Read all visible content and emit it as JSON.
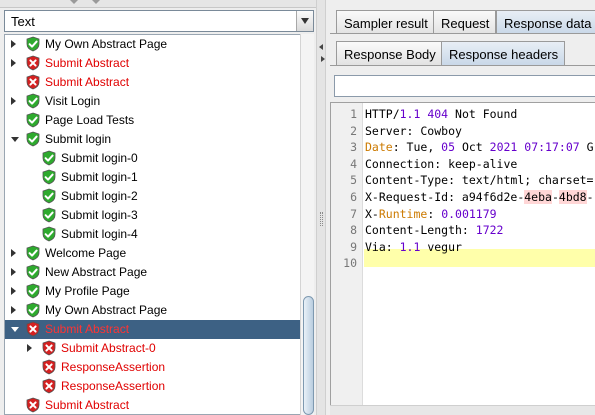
{
  "view_selector": {
    "value": "Text"
  },
  "tree": {
    "items": [
      {
        "label": "My Own Abstract Page",
        "status": "ok",
        "depth": 0,
        "expander": "collapsed",
        "selected": false,
        "icon": "shield-check-icon"
      },
      {
        "label": "Submit Abstract",
        "status": "bad",
        "depth": 0,
        "expander": "collapsed",
        "selected": false,
        "icon": "shield-x-icon"
      },
      {
        "label": "Submit Abstract",
        "status": "bad",
        "depth": 0,
        "expander": "none",
        "selected": false,
        "icon": "shield-x-icon"
      },
      {
        "label": "Visit Login",
        "status": "ok",
        "depth": 0,
        "expander": "collapsed",
        "selected": false,
        "icon": "shield-check-icon"
      },
      {
        "label": "Page Load Tests",
        "status": "ok",
        "depth": 0,
        "expander": "none",
        "selected": false,
        "icon": "shield-check-icon"
      },
      {
        "label": "Submit login",
        "status": "ok",
        "depth": 0,
        "expander": "expanded",
        "selected": false,
        "icon": "shield-check-icon"
      },
      {
        "label": "Submit login-0",
        "status": "ok",
        "depth": 1,
        "expander": "none",
        "selected": false,
        "icon": "shield-check-icon"
      },
      {
        "label": "Submit login-1",
        "status": "ok",
        "depth": 1,
        "expander": "none",
        "selected": false,
        "icon": "shield-check-icon"
      },
      {
        "label": "Submit login-2",
        "status": "ok",
        "depth": 1,
        "expander": "none",
        "selected": false,
        "icon": "shield-check-icon"
      },
      {
        "label": "Submit login-3",
        "status": "ok",
        "depth": 1,
        "expander": "none",
        "selected": false,
        "icon": "shield-check-icon"
      },
      {
        "label": "Submit login-4",
        "status": "ok",
        "depth": 1,
        "expander": "none",
        "selected": false,
        "icon": "shield-check-icon"
      },
      {
        "label": "Welcome Page",
        "status": "ok",
        "depth": 0,
        "expander": "collapsed",
        "selected": false,
        "icon": "shield-check-icon"
      },
      {
        "label": "New Abstract Page",
        "status": "ok",
        "depth": 0,
        "expander": "collapsed",
        "selected": false,
        "icon": "shield-check-icon"
      },
      {
        "label": "My Profile Page",
        "status": "ok",
        "depth": 0,
        "expander": "collapsed",
        "selected": false,
        "icon": "shield-check-icon"
      },
      {
        "label": "My Own Abstract Page",
        "status": "ok",
        "depth": 0,
        "expander": "collapsed",
        "selected": false,
        "icon": "shield-check-icon"
      },
      {
        "label": "Submit Abstract",
        "status": "bad",
        "depth": 0,
        "expander": "expanded",
        "selected": true,
        "icon": "shield-x-icon"
      },
      {
        "label": "Submit Abstract-0",
        "status": "bad",
        "depth": 1,
        "expander": "collapsed",
        "selected": false,
        "icon": "shield-x-icon"
      },
      {
        "label": "ResponseAssertion",
        "status": "bad",
        "depth": 1,
        "expander": "none",
        "selected": false,
        "icon": "shield-x-icon"
      },
      {
        "label": "ResponseAssertion",
        "status": "bad",
        "depth": 1,
        "expander": "none",
        "selected": false,
        "icon": "shield-x-icon"
      },
      {
        "label": "Submit Abstract",
        "status": "bad",
        "depth": 0,
        "expander": "none",
        "selected": false,
        "icon": "shield-x-icon"
      }
    ]
  },
  "result_tabs": [
    {
      "label": "Sampler result",
      "active": false
    },
    {
      "label": "Request",
      "active": false
    },
    {
      "label": "Response data",
      "active": true
    }
  ],
  "response_tabs": [
    {
      "label": "Response Body",
      "active": false
    },
    {
      "label": "Response headers",
      "active": true
    }
  ],
  "search": {
    "value": ""
  },
  "response_headers": {
    "lines": [
      [
        {
          "t": "HTTP/"
        },
        {
          "t": "1.1 404",
          "c": "num"
        },
        {
          "t": " Not Found"
        }
      ],
      [
        {
          "t": "Server: Cowboy"
        }
      ],
      [
        {
          "t": "Date",
          "c": "yel"
        },
        {
          "t": ": Tue, "
        },
        {
          "t": "05",
          "c": "num"
        },
        {
          "t": " Oct "
        },
        {
          "t": "2021 07:17:07",
          "c": "num"
        },
        {
          "t": " G"
        }
      ],
      [
        {
          "t": "Connection: keep-alive"
        }
      ],
      [
        {
          "t": "Content-Type: text/html; charset="
        }
      ],
      [
        {
          "t": "X-Request-Id: a94f6d2e-"
        },
        {
          "t": "4eba",
          "c": "hl"
        },
        {
          "t": "-"
        },
        {
          "t": "4bd8",
          "c": "hl"
        },
        {
          "t": "-"
        }
      ],
      [
        {
          "t": "X-"
        },
        {
          "t": "Runtime",
          "c": "yel"
        },
        {
          "t": ": "
        },
        {
          "t": "0.001179",
          "c": "num"
        }
      ],
      [
        {
          "t": "Content-Length: "
        },
        {
          "t": "1722",
          "c": "num"
        }
      ],
      [
        {
          "t": "Via: "
        },
        {
          "t": "1.1",
          "c": "num"
        },
        {
          "t": " vegur"
        }
      ],
      []
    ]
  },
  "colors": {
    "ok_text": "#000000",
    "error_text": "#e00000",
    "selection_bg": "#3d6184",
    "ok_icon": "#2eaa2e",
    "error_icon": "#d42020",
    "current_line": "#ffffaa"
  }
}
